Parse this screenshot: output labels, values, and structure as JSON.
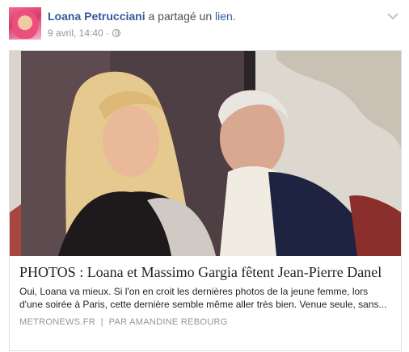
{
  "post": {
    "author": "Loana Petrucciani",
    "action_text": " a partagé un ",
    "link_word": "lien",
    "action_end": ".",
    "timestamp": "9 avril, 14:40",
    "separator": " · ",
    "audience_icon": "globe-icon",
    "menu_icon": "chevron-down-icon"
  },
  "card": {
    "title": "PHOTOS : Loana et Massimo Gargia fêtent Jean-Pierre Danel",
    "description": "Oui, Loana va mieux. Si l'on en croit les dernières photos de la jeune femme, lors d'une soirée à Paris, cette dernière semble même aller très bien. Venue seule, sans...",
    "source": "METRONEWS.FR",
    "source_sep": "  |  ",
    "byline": "PAR AMANDINE REBOURG"
  },
  "colors": {
    "link_blue": "#365899",
    "meta_gray": "#90949c",
    "text_dark": "#1d2129"
  }
}
